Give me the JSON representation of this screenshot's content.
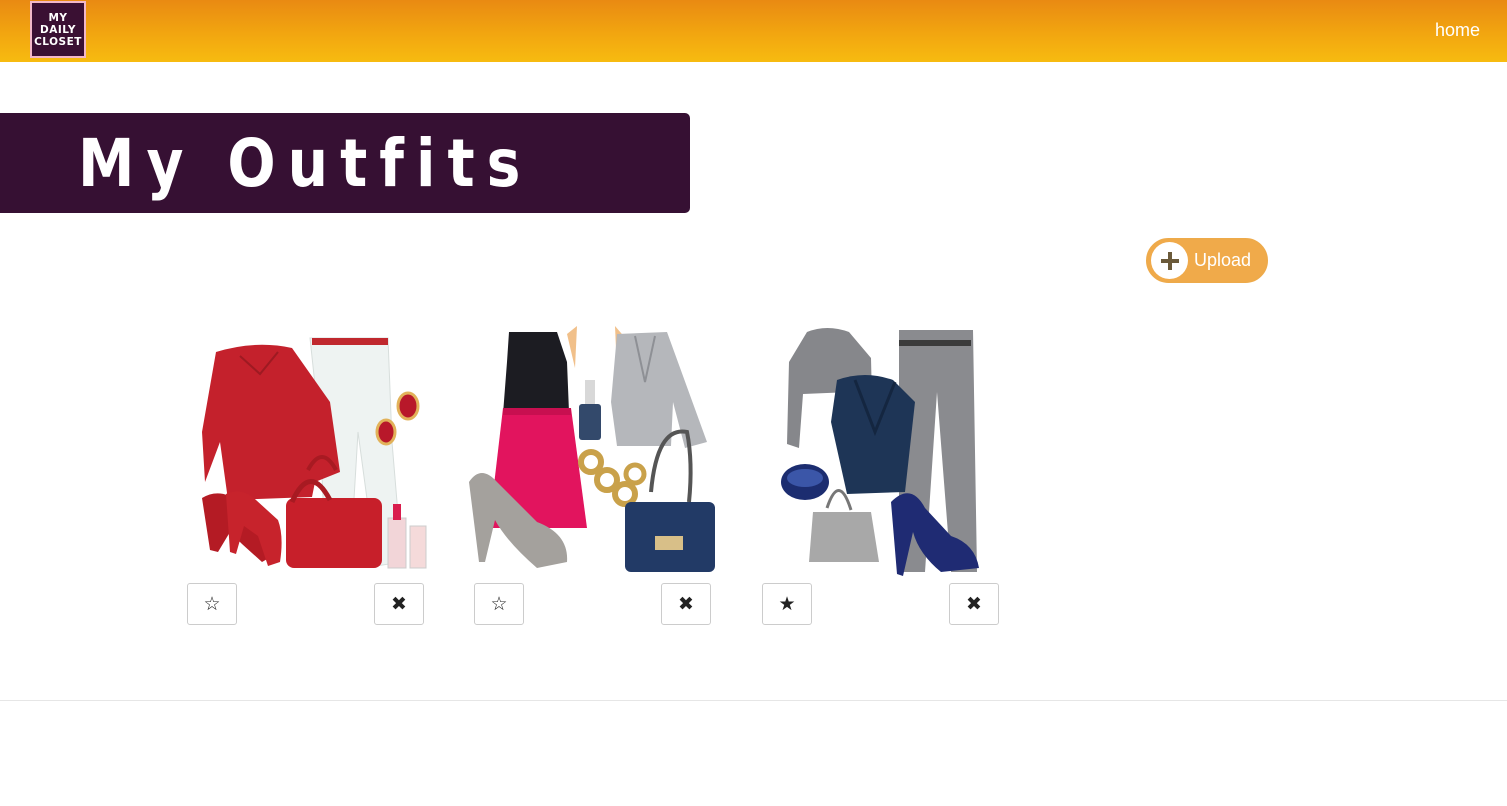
{
  "navbar": {
    "logo_lines": [
      "MY",
      "DAILY",
      "CLOSET"
    ],
    "home_label": "home"
  },
  "page": {
    "title": "My Outfits",
    "upload_label": "Upload"
  },
  "outfits": [
    {
      "favorited": false,
      "star_glyph": "☆",
      "delete_glyph": "✖",
      "items": [
        "red-sweater",
        "white-jeans",
        "red-earrings",
        "red-heels",
        "red-handbag",
        "lipstick"
      ]
    },
    {
      "favorited": false,
      "star_glyph": "☆",
      "delete_glyph": "✖",
      "items": [
        "black-top",
        "pink-skirt",
        "gold-earrings",
        "nail-polish",
        "grey-blazer",
        "grey-heels",
        "gold-bracelet",
        "navy-handbag"
      ]
    },
    {
      "favorited": true,
      "star_glyph": "★",
      "delete_glyph": "✖",
      "items": [
        "grey-hoodie",
        "navy-wrap-top",
        "grey-trousers",
        "navy-bangle",
        "grey-handbag",
        "navy-heels"
      ]
    }
  ],
  "colors": {
    "nav_top": "#e98a12",
    "nav_bottom": "#f7bb10",
    "banner": "#361033",
    "upload": "#f0aa4a"
  }
}
